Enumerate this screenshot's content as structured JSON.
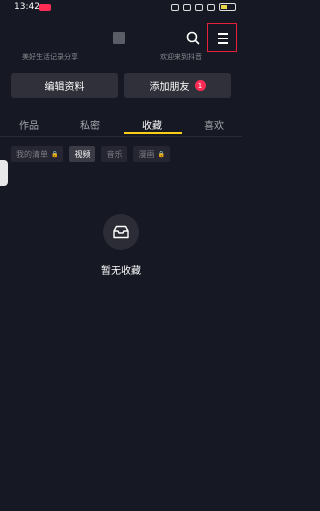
{
  "status_bar": {
    "time": "13:42"
  },
  "top_nav": {
    "hint_left": "美好生活记录分享",
    "hint_right": "欢迎来到抖音"
  },
  "actions": {
    "edit_label": "编辑资料",
    "add_friend_label": "添加朋友",
    "add_friend_badge": "1"
  },
  "tabs": [
    "作品",
    "私密",
    "收藏",
    "喜欢"
  ],
  "chips": [
    "我的清单",
    "视频",
    "音乐",
    "漫画"
  ],
  "empty_state": {
    "text": "暂无收藏"
  },
  "colors": {
    "accent": "#face15",
    "badge": "#fe2c55",
    "highlight_border": "#e5203a"
  }
}
